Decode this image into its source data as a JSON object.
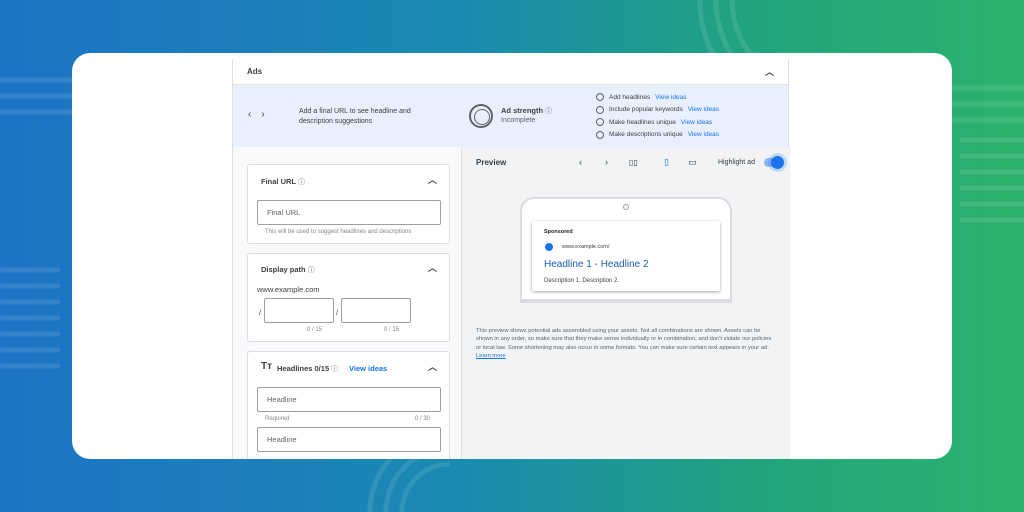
{
  "ads": {
    "title": "Ads",
    "collapse_icon": "chevron-up-icon"
  },
  "strength": {
    "suggest_text": "Add a final URL to see headline and description suggestions",
    "label": "Ad strength",
    "status": "Incomplete",
    "checklist": [
      {
        "label": "Add headlines",
        "link": "View ideas"
      },
      {
        "label": "Include popular keywords",
        "link": "View ideas"
      },
      {
        "label": "Make headlines unique",
        "link": "View ideas"
      },
      {
        "label": "Make descriptions unique",
        "link": "View ideas"
      }
    ]
  },
  "final_url": {
    "title": "Final URL",
    "placeholder": "Final URL",
    "hint": "This will be used to suggest headlines and descriptions"
  },
  "display_path": {
    "title": "Display path",
    "domain": "www.example.com",
    "separator": "/",
    "path1_count": "0 / 15",
    "path2_count": "0 / 15"
  },
  "headlines": {
    "title": "Headlines 0/15",
    "view_ideas": "View ideas",
    "field1_placeholder": "Headline",
    "field1_required": "Required",
    "field1_count": "0 / 30",
    "field2_placeholder": "Headline"
  },
  "preview": {
    "label": "Preview",
    "highlight_label": "Highlight ad",
    "highlight_on": true,
    "ad": {
      "sponsored": "Sponsored",
      "url": "www.example.com/",
      "headline": "Headline 1 - Headline 2",
      "description": "Description 1. Description 2."
    },
    "disclaimer": "This preview shows potential ads assembled using your assets. Not all combinations are shown. Assets can be shown in any order, so make sure that they make sense individually or in combination, and don't violate our policies or local law. Some shortening may also occur in some formats. You can make sure certain text appears in your ad.",
    "learn_more": "Learn more"
  },
  "colors": {
    "accent": "#1a73e8",
    "strength_bg": "#e8f0fe"
  }
}
